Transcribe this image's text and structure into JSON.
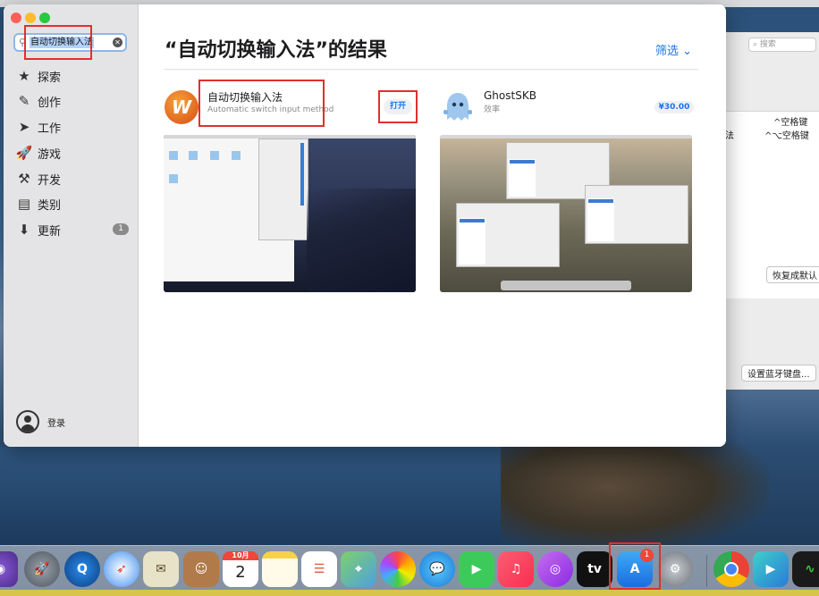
{
  "sidebar": {
    "search": {
      "value": "自动切换输入法",
      "clear_icon": "clear-circle-icon"
    },
    "nav": [
      {
        "label": "探索",
        "icon": "star-icon"
      },
      {
        "label": "创作",
        "icon": "brush-icon"
      },
      {
        "label": "工作",
        "icon": "paper-plane-icon"
      },
      {
        "label": "游戏",
        "icon": "rocket-icon"
      },
      {
        "label": "开发",
        "icon": "hammer-icon"
      },
      {
        "label": "类别",
        "icon": "stack-icon"
      },
      {
        "label": "更新",
        "icon": "download-icon",
        "badge": "1"
      }
    ],
    "login_label": "登录"
  },
  "main": {
    "title": "“自动切换输入法”的结果",
    "filter_label": "筛选",
    "results": [
      {
        "name": "自动切换输入法",
        "subtitle": "Automatic switch input method",
        "action": "打开"
      },
      {
        "name": "GhostSKB",
        "subtitle": "效率",
        "action": "¥30.00"
      }
    ]
  },
  "background_window": {
    "search_placeholder": "搜索",
    "rows": [
      "^空格键",
      "^⌥空格键"
    ],
    "row_prefix": "法",
    "restore_button": "恢复成默认",
    "bluetooth_button": "设置蓝牙键盘..."
  },
  "dock": {
    "calendar_month": "10月",
    "calendar_day": "2",
    "appstore_badge": "1",
    "tv_label": "tv"
  },
  "colors": {
    "accent": "#1a73e8",
    "highlight": "#e03030",
    "sidebar_bg": "#e4e4e6"
  }
}
